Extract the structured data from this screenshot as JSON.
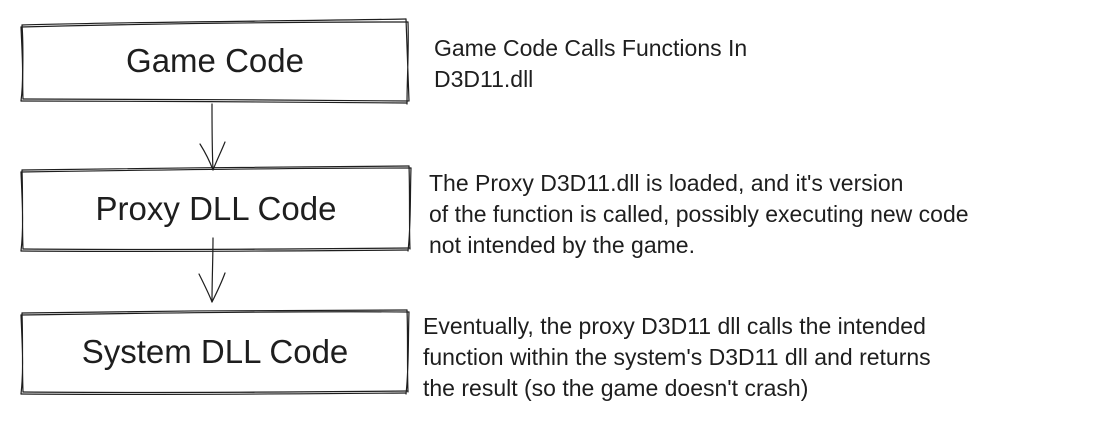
{
  "boxes": [
    {
      "label": "Game Code"
    },
    {
      "label": "Proxy DLL Code"
    },
    {
      "label": "System DLL Code"
    }
  ],
  "notes": [
    {
      "lines": [
        "Game Code Calls Functions In",
        "D3D11.dll"
      ]
    },
    {
      "lines": [
        "The Proxy D3D11.dll is loaded, and it's version",
        "of the function is called, possibly executing new code",
        "not intended by the game."
      ]
    },
    {
      "lines": [
        "Eventually, the proxy D3D11 dll calls the intended",
        "function within the system's D3D11 dll and returns",
        "the result (so the game doesn't crash)"
      ]
    }
  ]
}
